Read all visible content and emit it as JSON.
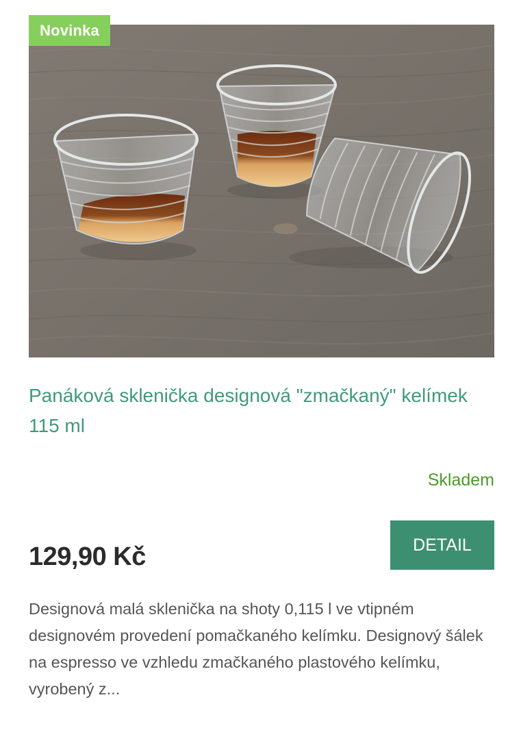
{
  "product": {
    "badge": "Novinka",
    "title": "Panáková sklenička designová \"zmačkaný\" kelímek 115 ml",
    "availability": "Skladem",
    "price": "129,90 Kč",
    "detail_label": "DETAIL",
    "description": "Designová malá sklenička na shoty 0,115 l ve vtipném designovém provedení pomačkaného kelímku. Designový šálek na espresso ve vzhledu zmačkaného plastového kelímku, vyrobený z...",
    "image_alt": "three crumpled-cup shot glasses on a wooden table"
  },
  "colors": {
    "badge_bg": "#86cf5c",
    "title": "#3f9a78",
    "stock": "#4c9b26",
    "button_bg": "#3d8f72",
    "price": "#2b2b2b",
    "description": "#555555"
  }
}
